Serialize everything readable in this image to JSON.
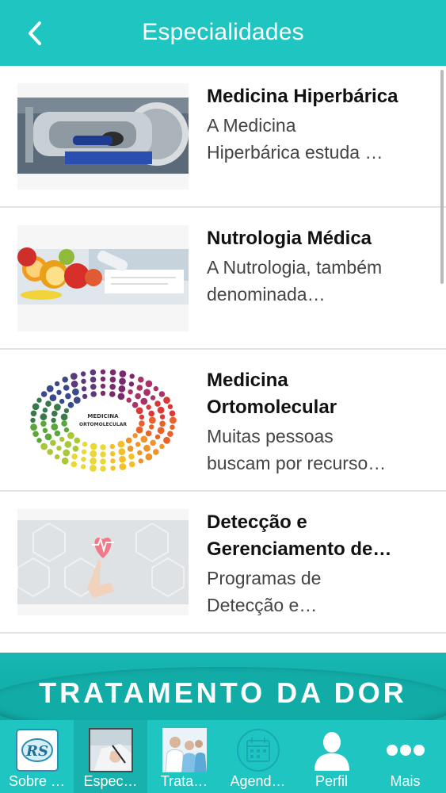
{
  "header": {
    "title": "Especialidades",
    "back_icon": "chevron-left-icon"
  },
  "items": [
    {
      "name": "Medicina Hiperbárica",
      "desc_line1": "A Medicina",
      "desc_line2": "Hiperbárica estuda …"
    },
    {
      "name": "Nutrologia Médica",
      "desc_line1": "A Nutrologia, também",
      "desc_line2": "denominada…"
    },
    {
      "name_line1": "Medicina",
      "name_line2": "Ortomolecular",
      "desc_line1": "Muitas pessoas",
      "desc_line2": "buscam por recurso…",
      "image_text_line1": "MEDICINA",
      "image_text_line2": "ORTOMOLECULAR"
    },
    {
      "name_line1": "Detecção e",
      "name_line2": "Gerenciamento de…",
      "desc_line1": "Programas de",
      "desc_line2": "Detecção e…"
    }
  ],
  "banner": {
    "text": "TRATAMENTO DA DOR"
  },
  "tabs": [
    {
      "label": "Sobre …",
      "icon": "rs-logo-icon",
      "logo_text": "RS"
    },
    {
      "label": "Espec…",
      "icon": "doctor-writing-icon"
    },
    {
      "label": "Trata…",
      "icon": "medical-team-icon"
    },
    {
      "label": "Agend…",
      "icon": "calendar-icon"
    },
    {
      "label": "Perfil",
      "icon": "person-icon"
    },
    {
      "label": "Mais",
      "icon": "more-dots-icon"
    }
  ],
  "colors": {
    "accent": "#1fc5c0",
    "active_tab": "#18b1ad",
    "banner": "#12aca7"
  }
}
